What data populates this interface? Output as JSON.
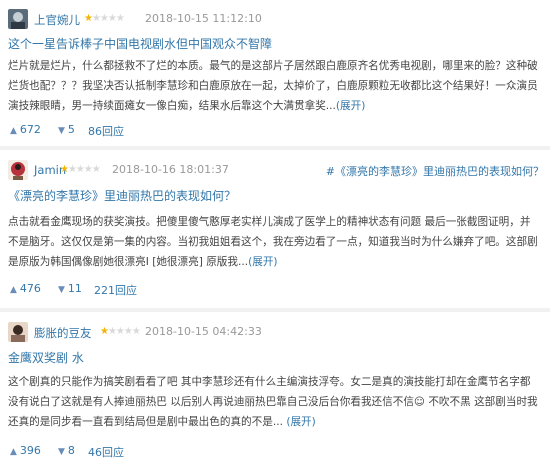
{
  "reviews": [
    {
      "user": "上官婉儿",
      "rating": 1,
      "time": "2018-10-15 11:12:10",
      "title": "这个一星告诉棒子中国电视剧水但中国观众不智障",
      "body": "烂片就是烂片，什么都拯救不了烂的本质。最气的是这部片子居然跟白鹿原齐名优秀电视剧，哪里来的脸？这种破烂货也配？？？我坚决否认抵制李慧珍和白鹿原放在一起，太掉价了，白鹿原颗粒无收都比这个结果好！一众演员演技辣眼睛，男一持续面瘫女一像白痴，结果水后靠这个大满贯拿奖...",
      "expand": "(展开)",
      "up": "672",
      "down": "5",
      "replies": "86回应"
    },
    {
      "user": "Jamin",
      "rating": 1,
      "time": "2018-10-16 18:01:37",
      "ref": "#《漂亮的李慧珍》里迪丽热巴的表现如何？",
      "title": "《漂亮的李慧珍》里迪丽热巴的表现如何？",
      "body": "点击就看金鹰现场的获奖演技。把傻里傻气憨厚老实样儿演成了医学上的精神状态有问题 最后一张截图证明，并不是脑牙。这仅仅是第一集的内容。当初我姐姐看这个，我在旁边看了一点，知道我当时为什么嫌弃了吧。这部剧是原版为韩国偶像剧她很漂亮I [她很漂亮] 原版我...",
      "expand": "(展开)",
      "up": "476",
      "down": "11",
      "replies": "221回应"
    },
    {
      "user": "膨胀的豆友",
      "rating": 1,
      "time": "2018-10-15 04:42:33",
      "title": "金鹰双奖剧 水",
      "body": "这个剧真的只能作为搞笑剧看看了吧 其中李慧珍还有什么主编演技浮夸。女二是真的演技能打却在金鹰节名字都没有说白了这就是有人捧迪丽热巴 以后别人再说迪丽热巴靠自己没后台你看我还信不信☺ 不吹不黑 这部剧当时我还真的是同步看一直看到结局但是剧中最出色的真的不是... ",
      "expand": "(展开)",
      "up": "396",
      "down": "8",
      "replies": "46回应"
    }
  ]
}
